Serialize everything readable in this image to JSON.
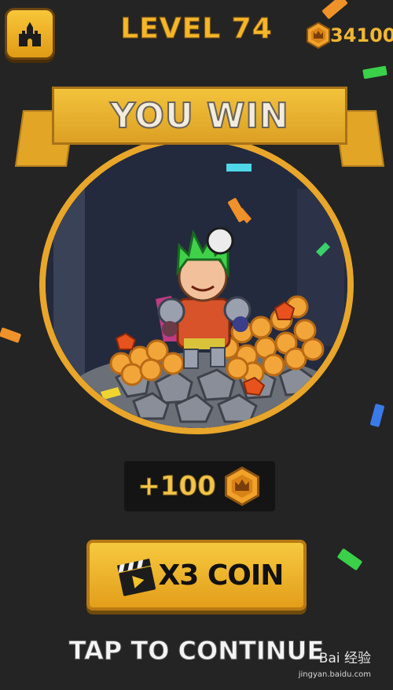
{
  "header": {
    "level_label": "LEVEL 74",
    "coin_total": "34100",
    "home_icon": "castle-icon"
  },
  "banner": {
    "title": "YOU WIN"
  },
  "reward": {
    "amount": "+100",
    "coin_icon": "crown-coin-icon"
  },
  "multiplier_button": {
    "label": "X3 COIN",
    "icon": "video-clapper-icon"
  },
  "continue": {
    "label": "TAP TO CONTINUE"
  },
  "watermark": {
    "text": "Bai 经验",
    "url": "jingyan.baidu.com"
  },
  "colors": {
    "gold": "#f2b632",
    "background": "#242424",
    "banner": "#e2a525"
  }
}
